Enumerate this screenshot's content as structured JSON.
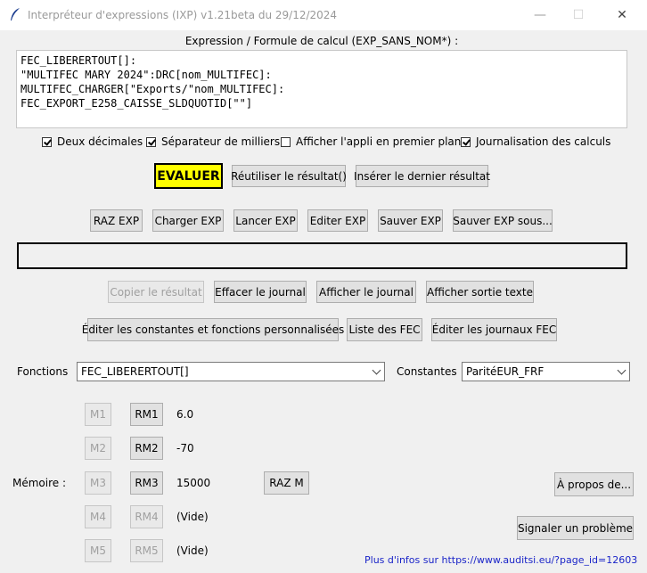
{
  "window": {
    "title": "Interpréteur d'expressions (IXP) v1.21beta du 29/12/2024",
    "icon": "feather-icon",
    "minimize": "—",
    "maximize": "☐",
    "close": "✕"
  },
  "expression": {
    "header": "Expression / Formule de calcul (EXP_SANS_NOM*) :",
    "lines": [
      "FEC_LIBERERTOUT[]:",
      "\"MULTIFEC MARY 2024\":DRC[nom_MULTIFEC]:",
      "MULTIFEC_CHARGER[\"Exports/\"nom_MULTIFEC]:",
      "FEC_EXPORT_E258_CAISSE_SLDQUOTID[\"\"]"
    ]
  },
  "options": [
    {
      "label": "Deux décimales",
      "checked": true
    },
    {
      "label": "Séparateur de milliers",
      "checked": true
    },
    {
      "label": "Afficher l'appli en premier plan",
      "checked": false
    },
    {
      "label": "Journalisation des calculs",
      "checked": true
    }
  ],
  "row1": {
    "evaluate": "EVALUER",
    "reuse": "Réutiliser le résultat()",
    "insert_last": "Insérer le dernier résultat"
  },
  "row2": {
    "raz_exp": "RAZ EXP",
    "charger_exp": "Charger EXP",
    "lancer_exp": "Lancer EXP",
    "editer_exp": "Editer EXP",
    "sauver_exp": "Sauver EXP",
    "sauver_exp_sous": "Sauver EXP sous..."
  },
  "result": {
    "value": ""
  },
  "row3": {
    "copy_result": "Copier le résultat",
    "clear_log": "Effacer le journal",
    "show_log": "Afficher le journal",
    "show_text_output": "Afficher sortie texte"
  },
  "row4": {
    "edit_constants": "Éditer les constantes et fonctions personnalisées",
    "fec_list": "Liste des FEC",
    "edit_fec_logs": "Éditer les journaux FEC"
  },
  "selectors": {
    "functions_label": "Fonctions",
    "functions_value": "FEC_LIBERERTOUT[]",
    "constants_label": "Constantes",
    "constants_value": "ParitéEUR_FRF"
  },
  "memory": {
    "label": "Mémoire :",
    "raz_m": "RAZ M",
    "slots": [
      {
        "m": "M1",
        "rm": "RM1",
        "value": "6.0",
        "rm_enabled": true
      },
      {
        "m": "M2",
        "rm": "RM2",
        "value": "-70",
        "rm_enabled": true
      },
      {
        "m": "M3",
        "rm": "RM3",
        "value": "15000",
        "rm_enabled": true
      },
      {
        "m": "M4",
        "rm": "RM4",
        "value": "(Vide)",
        "rm_enabled": false
      },
      {
        "m": "M5",
        "rm": "RM5",
        "value": "(Vide)",
        "rm_enabled": false
      }
    ]
  },
  "about": "À propos de...",
  "report_problem": "Signaler un problème",
  "footer_link": "Plus d'infos sur https://www.auditsi.eu/?page_id=12603",
  "colors": {
    "evaluate_bg": "#ffff00",
    "link": "#1a24c8"
  }
}
